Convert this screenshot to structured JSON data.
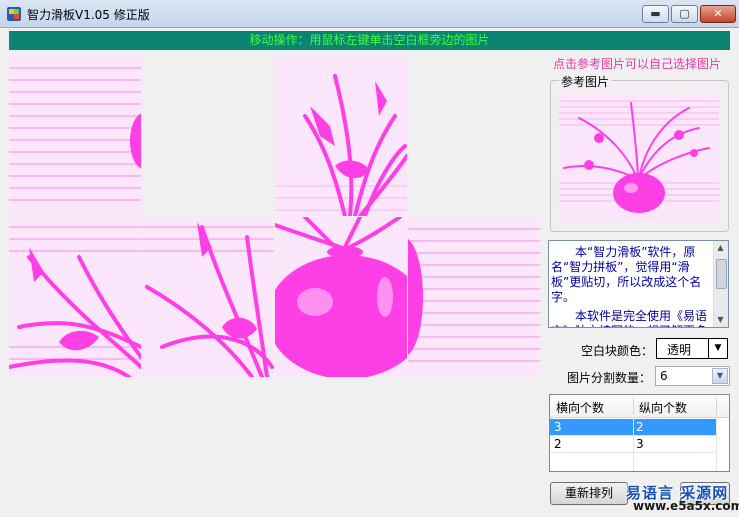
{
  "window": {
    "title": "智力滑板V1.05 修正版",
    "minimize_icon": "minimize-icon",
    "maximize_icon": "maximize-icon",
    "close_icon": "close-icon"
  },
  "hint_bar": "移动操作：用鼠标左键单击空白框旁边的图片",
  "reference": {
    "hint": "点击参考图片可以自己选择图片",
    "group_label": "参考图片"
  },
  "description": {
    "paragraphs": [
      "本“智力滑板”软件，原名“智力拼板”，觉得用“滑板”更贴切，所以改成这个名字。",
      "本软件是完全使用《易语言》独立编写的，想了解更多"
    ]
  },
  "settings": {
    "blank_color_label": "空白块颜色：",
    "blank_color_value": "透明",
    "split_label": "图片分割数量：",
    "split_value": "6"
  },
  "grid_list": {
    "columns": [
      "横向个数",
      "纵向个数"
    ],
    "rows": [
      {
        "h": "3",
        "v": "2",
        "selected": true
      },
      {
        "h": "2",
        "v": "3",
        "selected": false
      }
    ]
  },
  "buttons": {
    "shuffle": "重新排列"
  },
  "watermark": {
    "line1": "易语言 采源网",
    "line2": "www.e5a5x.com"
  },
  "colors": {
    "hint_bar_bg": "#0b8471",
    "hint_bar_text": "#3dff3d",
    "reference_hint": "#e23ba6",
    "description_text": "#0000a0",
    "picture_magenta": "#ff3fe6"
  }
}
